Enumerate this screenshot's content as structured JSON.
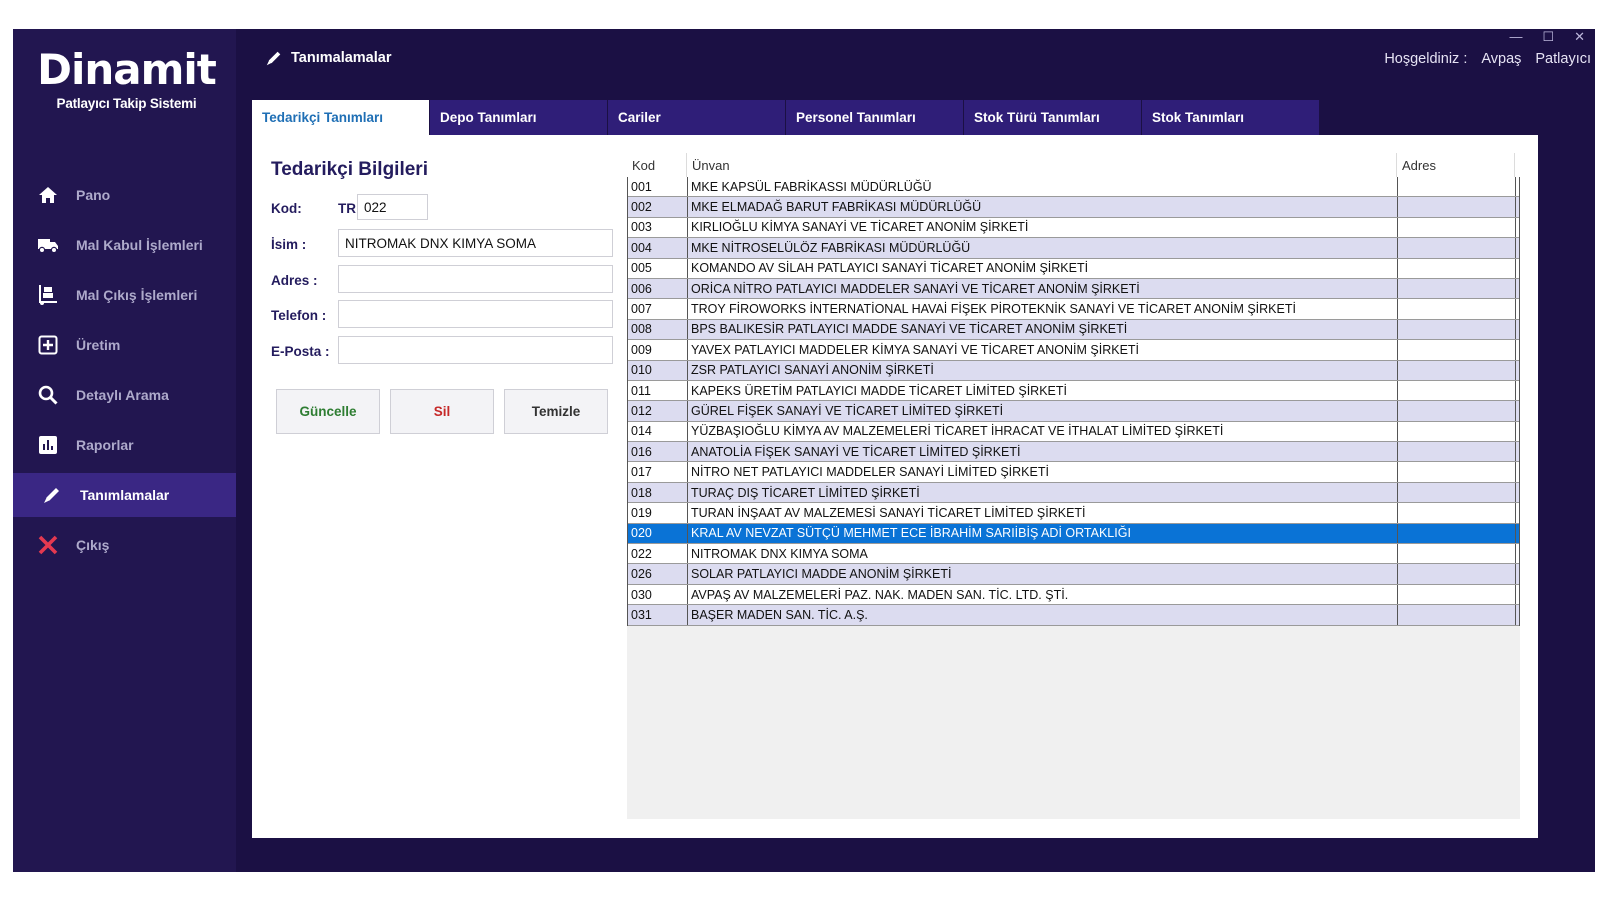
{
  "window": {
    "minimize": "—",
    "maximize": "☐",
    "close": "✕"
  },
  "brand": {
    "title": "Dinamit",
    "subtitle": "Patlayıcı Takip Sistemi"
  },
  "nav": [
    {
      "label": "Pano",
      "icon": "home-icon"
    },
    {
      "label": "Mal Kabul İşlemleri",
      "icon": "truck-icon"
    },
    {
      "label": "Mal Çıkış İşlemleri",
      "icon": "dolly-icon"
    },
    {
      "label": "Üretim",
      "icon": "plus-square-icon"
    },
    {
      "label": "Detaylı Arama",
      "icon": "search-icon"
    },
    {
      "label": "Raporlar",
      "icon": "chart-icon"
    },
    {
      "label": "Tanımlamalar",
      "icon": "pencil-icon",
      "active": true
    },
    {
      "label": "Çıkış",
      "icon": "close-icon"
    }
  ],
  "header": {
    "title": "Tanımalamalar",
    "welcome_label": "Hoşgeldiniz :",
    "user_first": "Avpaş",
    "user_last": "Patlayıcı"
  },
  "tabs": [
    "Tedarikçi Tanımları",
    "Depo Tanımları",
    "Cariler",
    "Personel Tanımları",
    "Stok Türü Tanımları",
    "Stok Tanımları"
  ],
  "form": {
    "title": "Tedarikçi Bilgileri",
    "kod_label": "Kod:",
    "kod_prefix": "TR",
    "kod_value": "022",
    "isim_label": "İsim :",
    "isim_value": "NITROMAK DNX KIMYA SOMA",
    "adres_label": "Adres :",
    "adres_value": "",
    "telefon_label": "Telefon :",
    "telefon_value": "",
    "eposta_label": "E-Posta :",
    "eposta_value": "",
    "update_label": "Güncelle",
    "delete_label": "Sil",
    "clear_label": "Temizle",
    "colors": {
      "update": "#2e7d32",
      "delete": "#c62828",
      "clear": "#333333"
    }
  },
  "grid": {
    "columns": [
      "Kod",
      "Ünvan",
      "Adres"
    ],
    "selected_index": 17,
    "rows": [
      {
        "kod": "001",
        "unvan": "MKE KAPSÜL FABRİKASSI MÜDÜRLÜĞÜ",
        "adres": ""
      },
      {
        "kod": "002",
        "unvan": "MKE ELMADAĞ BARUT FABRİKASI MÜDÜRLÜĞÜ",
        "adres": ""
      },
      {
        "kod": "003",
        "unvan": "KIRLIOĞLU KİMYA SANAYİ VE TİCARET ANONİM ŞİRKETİ",
        "adres": ""
      },
      {
        "kod": "004",
        "unvan": "MKE NİTROSELÜLÖZ FABRİKASI MÜDÜRLÜĞÜ",
        "adres": ""
      },
      {
        "kod": "005",
        "unvan": "KOMANDO AV SİLAH PATLAYICI SANAYİ TİCARET ANONİM ŞİRKETİ",
        "adres": ""
      },
      {
        "kod": "006",
        "unvan": "ORİCA NİTRO PATLAYICI MADDELER SANAYİ VE TİCARET ANONİM ŞİRKETİ",
        "adres": ""
      },
      {
        "kod": "007",
        "unvan": "TROY FİROWORKS İNTERNATİONAL HAVAİ FİŞEK PİROTEKNİK SANAYİ VE TİCARET ANONİM ŞİRKETİ",
        "adres": ""
      },
      {
        "kod": "008",
        "unvan": "BPS BALIKESİR PATLAYICI MADDE SANAYİ VE TİCARET ANONİM ŞİRKETİ",
        "adres": ""
      },
      {
        "kod": "009",
        "unvan": "YAVEX PATLAYICI MADDELER KİMYA SANAYİ VE TİCARET ANONİM ŞİRKETİ",
        "adres": ""
      },
      {
        "kod": "010",
        "unvan": "ZSR PATLAYICI SANAYİ ANONİM ŞİRKETİ",
        "adres": ""
      },
      {
        "kod": "011",
        "unvan": "KAPEKS ÜRETİM PATLAYICI MADDE TİCARET LİMİTED ŞİRKETİ",
        "adres": ""
      },
      {
        "kod": "012",
        "unvan": "GÜREL FİŞEK SANAYİ VE TİCARET LİMİTED ŞİRKETİ",
        "adres": ""
      },
      {
        "kod": "014",
        "unvan": "YÜZBAŞIOĞLU KİMYA AV MALZEMELERİ TİCARET İHRACAT VE İTHALAT LİMİTED ŞİRKETİ",
        "adres": ""
      },
      {
        "kod": "016",
        "unvan": "ANATOLİA FİŞEK SANAYİ VE TİCARET LİMİTED ŞİRKETİ",
        "adres": ""
      },
      {
        "kod": "017",
        "unvan": "NİTRO NET PATLAYICI MADDELER SANAYİ LİMİTED ŞİRKETİ",
        "adres": ""
      },
      {
        "kod": "018",
        "unvan": "TURAÇ DIŞ TİCARET LİMİTED ŞİRKETİ",
        "adres": ""
      },
      {
        "kod": "019",
        "unvan": "TURAN İNŞAAT AV MALZEMESİ SANAYİ TİCARET LİMİTED ŞİRKETİ",
        "adres": ""
      },
      {
        "kod": "020",
        "unvan": "KRAL AV NEVZAT SÜTÇÜ MEHMET ECE İBRAHİM SARIİBİŞ ADİ ORTAKLIĞI",
        "adres": ""
      },
      {
        "kod": "022",
        "unvan": "NITROMAK DNX KIMYA SOMA",
        "adres": ""
      },
      {
        "kod": "026",
        "unvan": "SOLAR PATLAYICI MADDE ANONİM ŞİRKETİ",
        "adres": ""
      },
      {
        "kod": "030",
        "unvan": "AVPAŞ AV MALZEMELERİ PAZ. NAK. MADEN SAN. TİC. LTD. ŞTİ.",
        "adres": ""
      },
      {
        "kod": "031",
        "unvan": "BAŞER MADEN SAN. TİC. A.Ş.",
        "adres": ""
      }
    ]
  }
}
